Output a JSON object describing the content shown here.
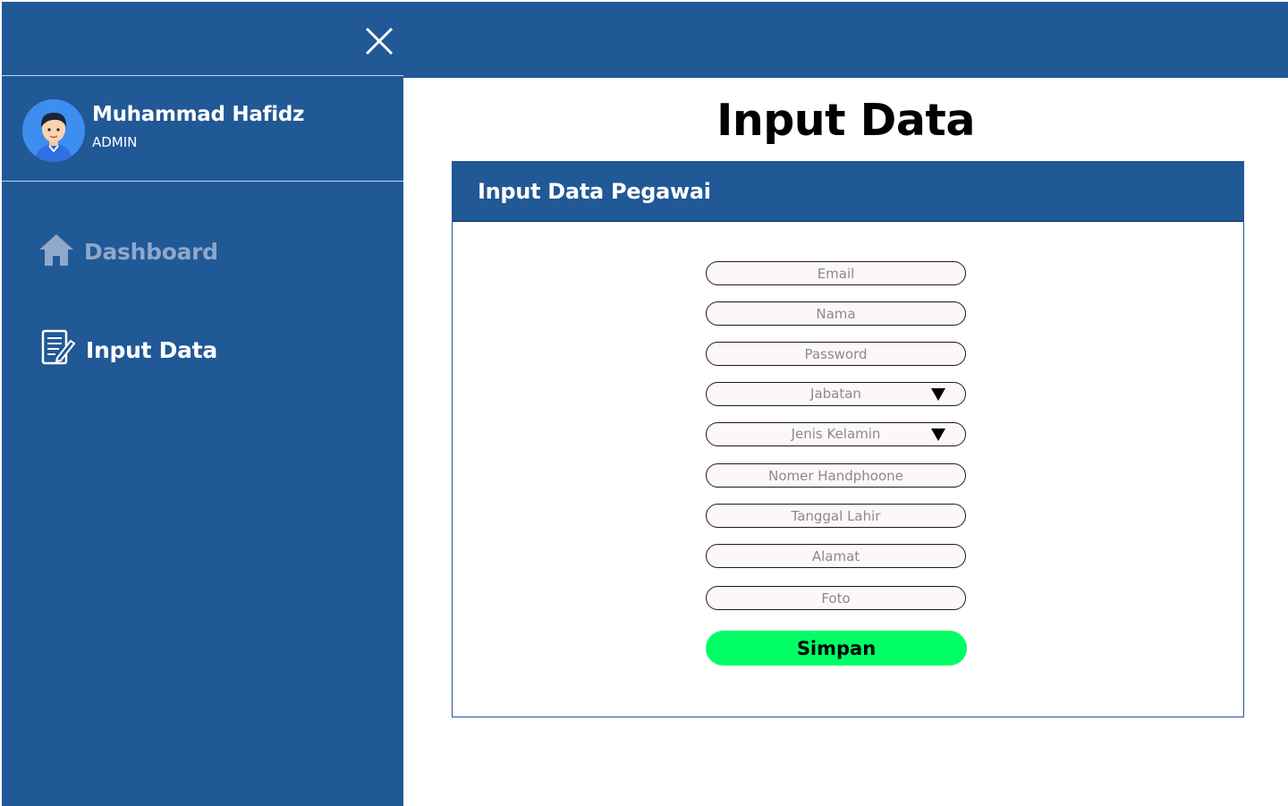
{
  "sidebar": {
    "user": {
      "name": "Muhammad Hafidz",
      "role": "ADMIN"
    },
    "items": [
      {
        "label": "Dashboard",
        "icon": "home-icon",
        "state": "inactive"
      },
      {
        "label": "Input Data",
        "icon": "edit-document-icon",
        "state": "active"
      }
    ]
  },
  "main": {
    "title": "Input Data",
    "card": {
      "title": "Input Data Pegawai",
      "fields": {
        "email": "Email",
        "nama": "Nama",
        "password": "Password",
        "jabatan": "Jabatan",
        "jenis_kelamin": "Jenis Kelamin",
        "nomer_handphone": "Nomer Handphoone",
        "tanggal_lahir": "Tanggal Lahir",
        "alamat": "Alamat",
        "foto": "Foto"
      },
      "submit_label": "Simpan"
    }
  },
  "colors": {
    "primary": "#215896",
    "accent_button": "#00ff66",
    "inactive_nav": "#8fa8cb",
    "field_bg": "#fdf8f7"
  }
}
